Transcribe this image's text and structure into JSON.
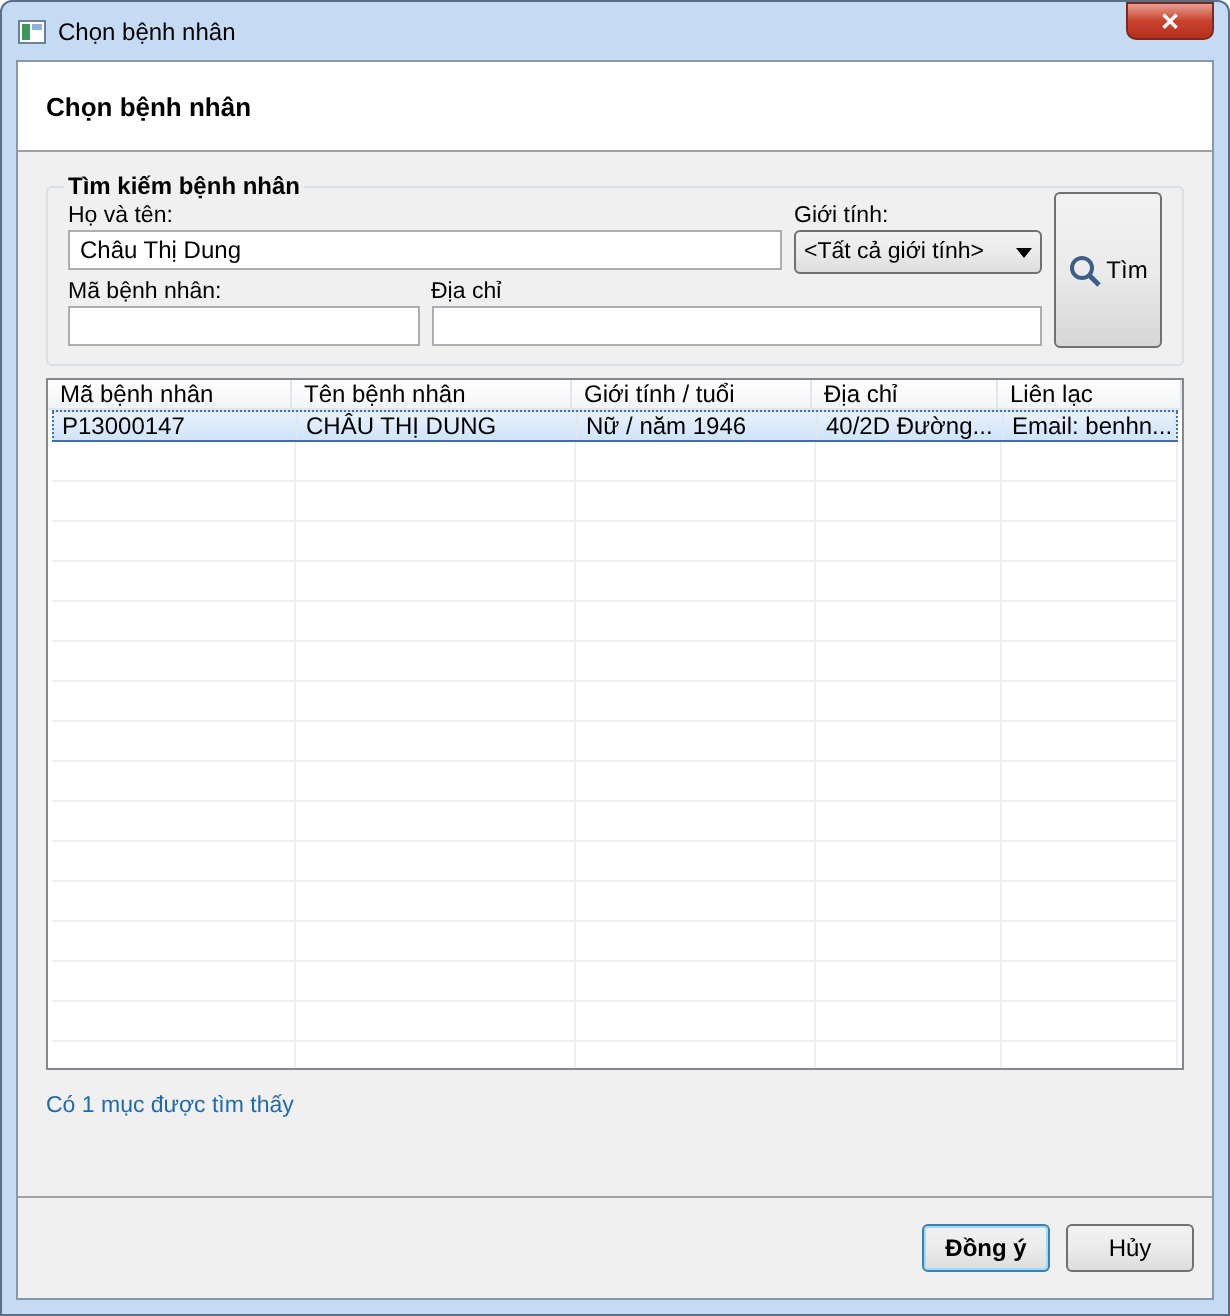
{
  "window": {
    "title": "Chọn bệnh nhân",
    "close_symbol": "✕"
  },
  "header": {
    "title": "Chọn bệnh nhân"
  },
  "search": {
    "title": "Tìm kiếm bệnh nhân",
    "name": {
      "label": "Họ và tên:",
      "value": "Châu Thị Dung"
    },
    "gender": {
      "label": "Giới tính:",
      "value": "<Tất cả giới tính>"
    },
    "patient_id": {
      "label": "Mã bệnh nhân:"
    },
    "address": {
      "label": "Địa chỉ"
    },
    "search_button": "Tìm"
  },
  "table": {
    "columns": [
      "Mã bệnh nhân",
      "Tên bệnh nhân",
      "Giới tính / tuổi",
      "Địa chỉ",
      "Liên lạc"
    ],
    "rows": [
      {
        "cells": [
          "P13000147",
          "CHÂU THỊ DUNG",
          "Nữ / năm 1946",
          "40/2D Đường...",
          "Email: benhn..."
        ],
        "selected": true
      }
    ]
  },
  "status": "Có 1 mục được tìm thấy",
  "buttons": [
    {
      "label": "Đồng ý",
      "default": true
    },
    {
      "label": "Hủy",
      "default": false
    }
  ]
}
